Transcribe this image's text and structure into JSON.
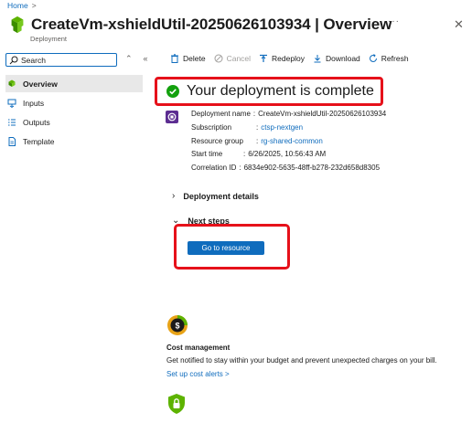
{
  "breadcrumb": {
    "home": "Home",
    "separator": ">"
  },
  "header": {
    "title": "CreateVm-xshieldUtil-20250626103934 | Overview",
    "subtitle": "Deployment",
    "more": "···",
    "close": "✕"
  },
  "sidebar": {
    "search_placeholder": "Search",
    "collapse_ctrls": [
      "⌃",
      "«"
    ],
    "items": [
      {
        "label": "Overview",
        "icon": "deployment-icon",
        "active": true
      },
      {
        "label": "Inputs",
        "icon": "inputs-icon",
        "active": false
      },
      {
        "label": "Outputs",
        "icon": "outputs-icon",
        "active": false
      },
      {
        "label": "Template",
        "icon": "template-icon",
        "active": false
      }
    ]
  },
  "toolbar": {
    "delete": "Delete",
    "cancel": "Cancel",
    "redeploy": "Redeploy",
    "download": "Download",
    "refresh": "Refresh"
  },
  "status": {
    "text": "Your deployment is complete"
  },
  "details": {
    "rows": [
      {
        "label": "Deployment name",
        "sep": ":",
        "value": "CreateVm-xshieldUtil-20250626103934",
        "link": false
      },
      {
        "label": "Subscription",
        "sep": ":",
        "value": "ctsp-nextgen",
        "link": true
      },
      {
        "label": "Resource group",
        "sep": ":",
        "value": "rg-shared-common",
        "link": true
      },
      {
        "label": "Start time",
        "sep": ":",
        "value": "6/26/2025, 10:56:43 AM",
        "link": false
      },
      {
        "label": "Correlation ID",
        "sep": ":",
        "value": "6834e902-5635-48ff-b278-232d658d8305",
        "link": false
      }
    ]
  },
  "sections": {
    "deployment_details": "Deployment details",
    "next_steps": "Next steps"
  },
  "go_to_resource": "Go to resource",
  "cost": {
    "title": "Cost management",
    "description": "Get notified to stay within your budget and prevent unexpected charges on your bill.",
    "link": "Set up cost alerts >"
  },
  "colors": {
    "accent": "#0f6cbd",
    "highlight_box": "#e6111a",
    "success": "#13a10e"
  }
}
